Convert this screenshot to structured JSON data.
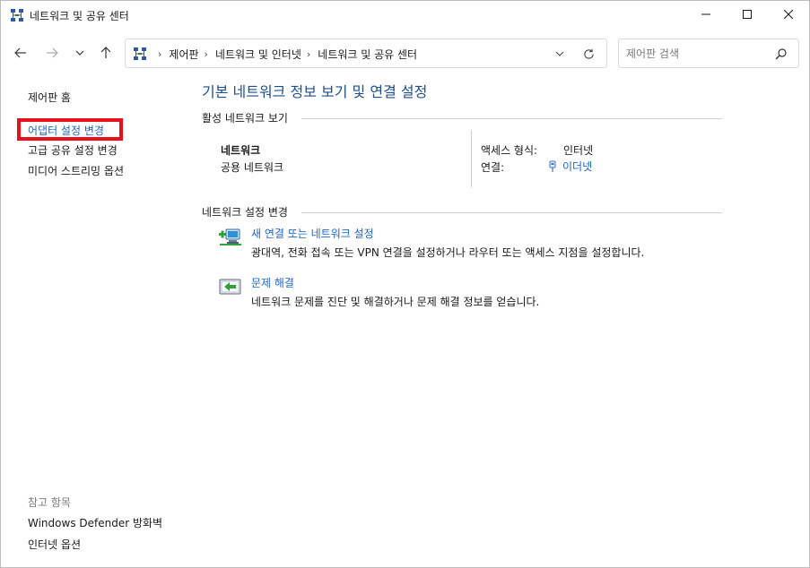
{
  "window": {
    "title": "네트워크 및 공유 센터"
  },
  "nav": {
    "breadcrumbs": [
      "제어판",
      "네트워크 및 인터넷",
      "네트워크 및 공유 센터"
    ],
    "search_placeholder": "제어판 검색"
  },
  "sidebar": {
    "home": "제어판 홈",
    "items": [
      "어댑터 설정 변경",
      "고급 공유 설정 변경",
      "미디어 스트리밍 옵션"
    ],
    "see_also_heading": "참고 항목",
    "see_also": [
      "Windows Defender 방화벽",
      "인터넷 옵션"
    ],
    "highlight_color": "#e8101b"
  },
  "main": {
    "title": "기본 네트워크 정보 보기 및 연결 설정",
    "active_networks_heading": "활성 네트워크 보기",
    "network": {
      "name": "네트워크",
      "type": "공용 네트워크",
      "access_type_label": "액세스 형식:",
      "access_type_value": "인터넷",
      "connections_label": "연결:",
      "connections_value": "이더넷"
    },
    "change_settings_heading": "네트워크 설정 변경",
    "tasks": [
      {
        "title": "새 연결 또는 네트워크 설정",
        "description": "광대역, 전화 접속 또는 VPN 연결을 설정하거나 라우터 또는 액세스 지점을 설정합니다.",
        "icon": "network-setup-icon"
      },
      {
        "title": "문제 해결",
        "description": "네트워크 문제를 진단 및 해결하거나 문제 해결 정보를 얻습니다.",
        "icon": "troubleshoot-icon"
      }
    ]
  },
  "colors": {
    "link": "#1d64c8",
    "title": "#1e4e8c"
  }
}
